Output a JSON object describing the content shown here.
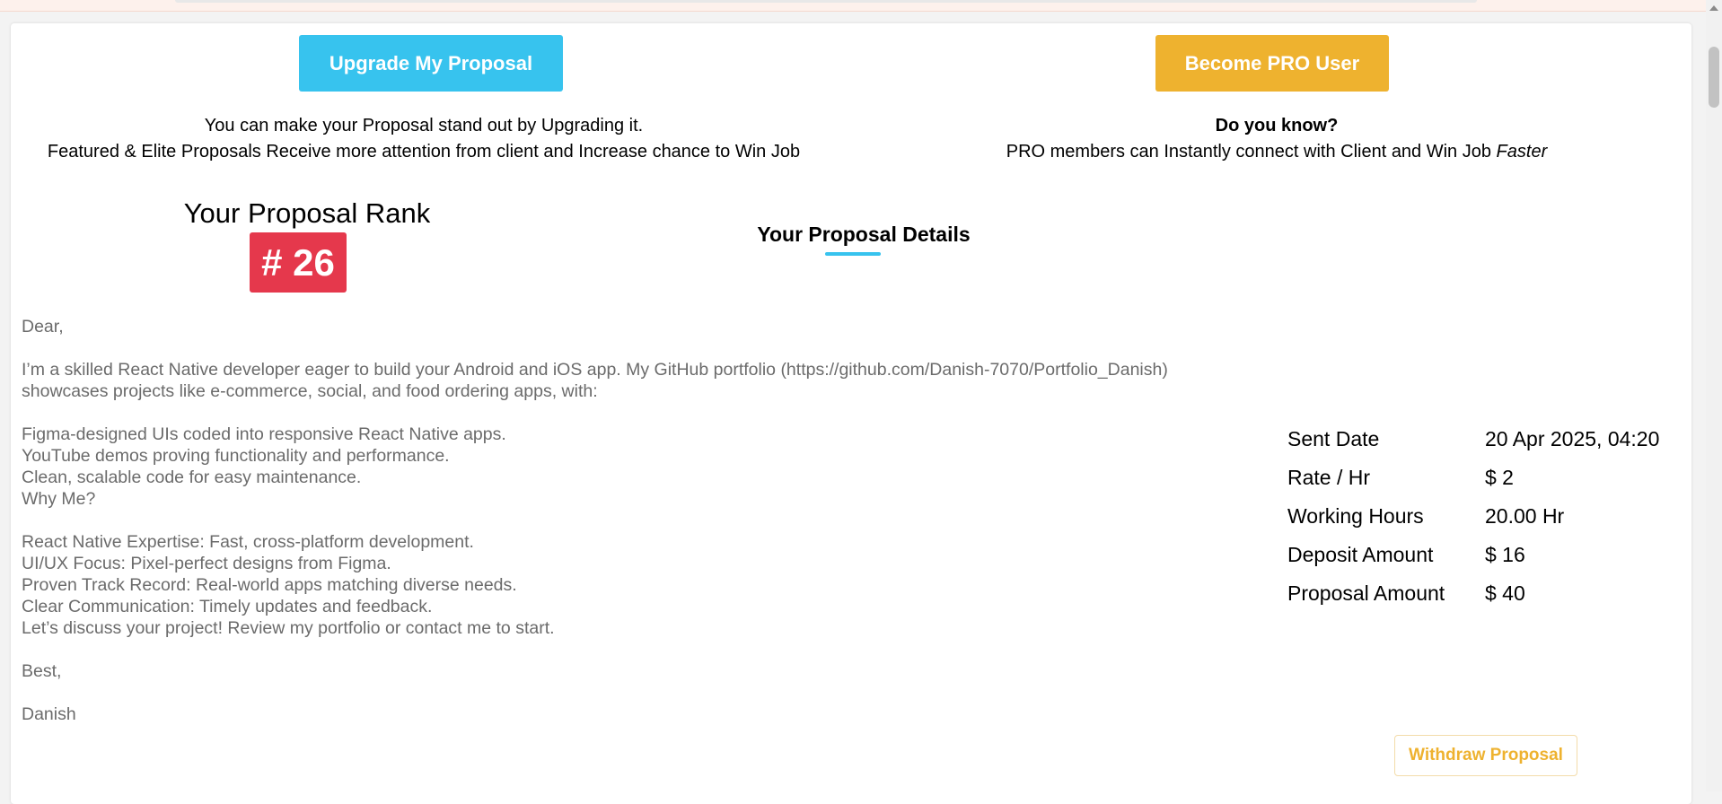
{
  "actions": {
    "upgrade_label": "Upgrade My Proposal",
    "pro_label": "Become PRO User",
    "withdraw_label": "Withdraw Proposal"
  },
  "upgrade_info": {
    "line1": "You can make your Proposal stand out by Upgrading it.",
    "line2": "Featured & Elite Proposals Receive more attention from client and Increase chance to Win Job"
  },
  "pro_info": {
    "heading": "Do you know?",
    "line": "PRO members can Instantly connect with Client and Win Job",
    "emphasis": "Faster"
  },
  "rank": {
    "title": "Your Proposal Rank",
    "value": "# 26"
  },
  "details": {
    "title": "Your Proposal Details"
  },
  "letter": {
    "greeting": "Dear,",
    "intro1": "I’m a skilled React Native developer eager to build your Android and iOS app. My GitHub portfolio (https://github.com/Danish-7070/Portfolio_Danish)",
    "intro2": "showcases projects like e-commerce, social, and food ordering apps, with:",
    "features": [
      "Figma-designed UIs coded into responsive React Native apps.",
      "YouTube demos proving functionality and performance.",
      "Clean, scalable code for easy maintenance.",
      "Why Me?"
    ],
    "reasons": [
      "React Native Expertise: Fast, cross-platform development.",
      "UI/UX Focus: Pixel-perfect designs from Figma.",
      "Proven Track Record: Real-world apps matching diverse needs.",
      "Clear Communication: Timely updates and feedback.",
      "Let’s discuss your project! Review my portfolio or contact me to start."
    ],
    "closing": "Best,",
    "signature": "Danish"
  },
  "meta": [
    {
      "label": "Sent Date",
      "value": "20 Apr 2025, 04:20"
    },
    {
      "label": "Rate / Hr",
      "value": "$ 2"
    },
    {
      "label": "Working Hours",
      "value": "20.00 Hr"
    },
    {
      "label": "Deposit Amount",
      "value": "$ 16"
    },
    {
      "label": "Proposal Amount",
      "value": "$ 40"
    }
  ],
  "colors": {
    "upgrade": "#37c3ee",
    "pro": "#eeb22f",
    "rank_badge": "#e5384c",
    "body_text": "#6b6b6b"
  }
}
